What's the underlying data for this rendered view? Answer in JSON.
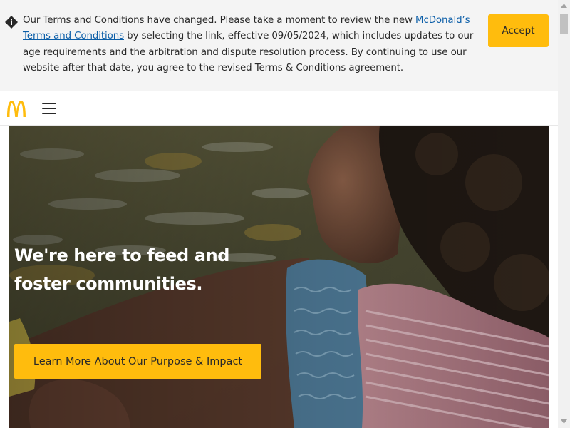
{
  "terms_banner": {
    "text_before_link": "Our Terms and Conditions have changed. Please take a moment to review the new ",
    "link_text": "McDonald’s Terms and Conditions",
    "text_after_link": " by selecting the link, effective 09/05/2024, which includes updates to our age requirements and the arbitration and dispute resolution process. By continuing to use our website after that date, you agree to the revised Terms & Conditions agreement.",
    "accept_label": "Accept",
    "icon": "info-icon"
  },
  "header": {
    "logo_icon": "golden-arches-logo",
    "menu_icon": "hamburger-menu-icon"
  },
  "hero": {
    "heading": "We're here to feed and foster communities.",
    "cta_label": "Learn More About Our Purpose & Impact"
  },
  "colors": {
    "brand_yellow": "#ffbc0d",
    "link_blue": "#0b5ea8",
    "banner_bg": "#f4f4f4",
    "text_dark": "#292929"
  }
}
